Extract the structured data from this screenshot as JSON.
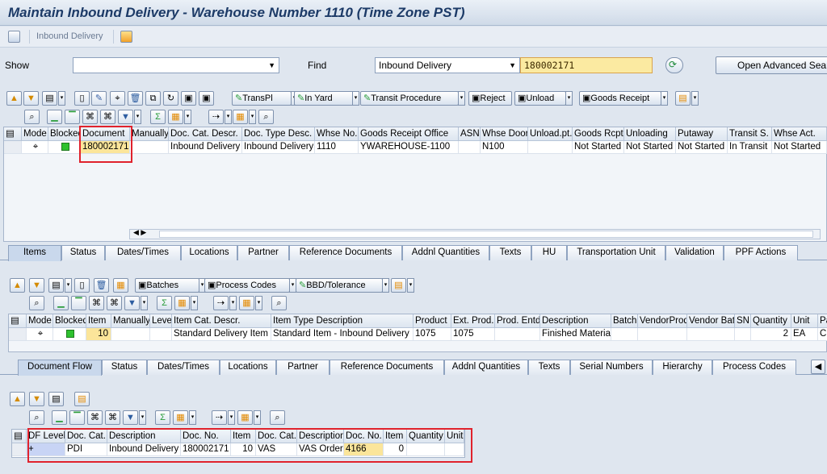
{
  "window": {
    "title": "Maintain Inbound Delivery - Warehouse Number 1110 (Time Zone PST)"
  },
  "app_toolbar": {
    "inbound_delivery_label": "Inbound Delivery"
  },
  "search": {
    "show_label": "Show",
    "show_value": "",
    "find_label": "Find",
    "find_value": "Inbound Delivery",
    "search_value": "180002171",
    "advanced_button": "Open Advanced Search"
  },
  "header_toolbar": {
    "transpl": "TransPl",
    "in_yard": "In Yard",
    "transit_procedure": "Transit Procedure",
    "reject": "Reject",
    "unload": "Unload",
    "goods_receipt": "Goods Receipt"
  },
  "header_grid": {
    "columns": [
      "Mode",
      "Blocked",
      "Document",
      "Manually",
      "Doc. Cat. Descr.",
      "Doc. Type Desc.",
      "Whse No.",
      "Goods Receipt Office",
      "ASN",
      "Whse Door",
      "Unload.pt.",
      "Goods Rcpt",
      "Unloading",
      "Putaway",
      "Transit S.",
      "Whse Act."
    ],
    "row": {
      "document": "180002171",
      "doc_cat_descr": "Inbound Delivery",
      "doc_type_desc": "Inbound Delivery",
      "whse_no": "1110",
      "gr_office": "YWAREHOUSE-1100",
      "whse_door": "N100",
      "goods_rcpt": "Not Started",
      "unloading": "Not Started",
      "putaway": "Not Started",
      "transit": "In Transit",
      "whse_act": "Not Started"
    }
  },
  "tabs1": [
    "Items",
    "Status",
    "Dates/Times",
    "Locations",
    "Partner",
    "Reference Documents",
    "Addnl Quantities",
    "Texts",
    "HU",
    "Transportation Unit",
    "Validation",
    "PPF Actions"
  ],
  "items_toolbar": {
    "batches": "Batches",
    "process_codes": "Process Codes",
    "bbd": "BBD/Tolerance"
  },
  "items_grid": {
    "columns": [
      "Mode",
      "Blocked",
      "Item",
      "Manually",
      "Level",
      "Item Cat. Descr.",
      "Item Type Description",
      "Product",
      "Ext. Prod.",
      "Prod. Entd",
      "Description",
      "Batch",
      "VendorProd",
      "Vendor Bat",
      "SN",
      "Quantity",
      "Unit",
      "Pa"
    ],
    "row": {
      "item": "10",
      "item_cat": "Standard Delivery Item",
      "item_type": "Standard Item - Inbound Delivery",
      "product": "1075",
      "ext_prod": "1075",
      "description": "Finished Material",
      "quantity": "2",
      "unit": "EA",
      "pa": "C"
    }
  },
  "tabs2": [
    "Document Flow",
    "Status",
    "Dates/Times",
    "Locations",
    "Partner",
    "Reference Documents",
    "Addnl Quantities",
    "Texts",
    "Serial Numbers",
    "Hierarchy",
    "Process Codes"
  ],
  "flow_grid": {
    "columns": [
      "DF Level",
      "Doc. Cat.",
      "Description",
      "Doc. No.",
      "Item",
      "Doc. Cat.",
      "Description",
      "Doc. No.",
      "Item",
      "Quantity",
      "Unit"
    ],
    "row": {
      "level": "+",
      "doc_cat": "PDI",
      "description": "Inbound Delivery",
      "doc_no": "180002171",
      "item": "10",
      "doc_cat2": "VAS",
      "description2": "VAS Order",
      "doc_no2": "4166",
      "item2": "0"
    }
  }
}
